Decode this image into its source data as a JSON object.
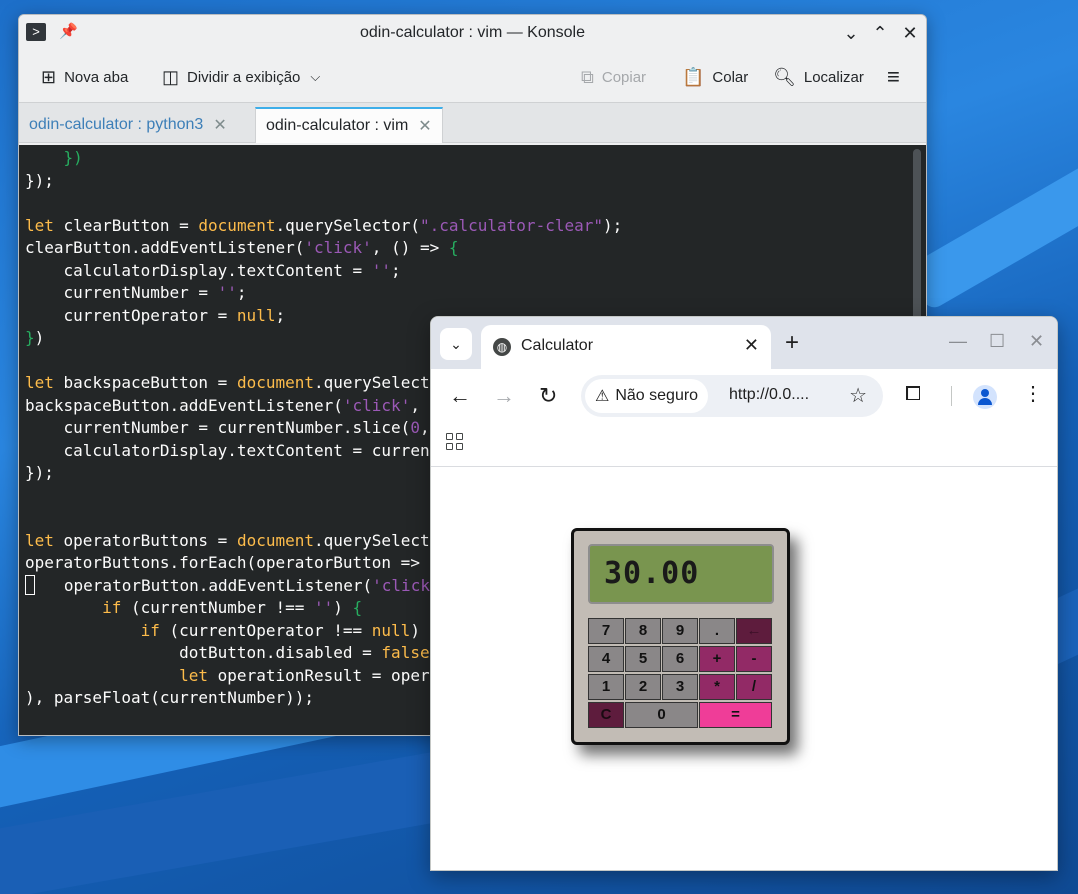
{
  "konsole": {
    "title": "odin-calculator : vim — Konsole",
    "toolbar": {
      "new_tab": "Nova aba",
      "split_view": "Dividir a exibição",
      "copy": "Copiar",
      "paste": "Colar",
      "find": "Localizar"
    },
    "tabs": [
      {
        "label": "odin-calculator : python3",
        "active": false
      },
      {
        "label": "odin-calculator : vim",
        "active": true
      }
    ]
  },
  "chrome": {
    "tab_title": "Calculator",
    "security_label": "Não seguro",
    "url": "http://0.0...."
  },
  "calculator": {
    "display": "30.00",
    "buttons": [
      "7",
      "8",
      "9",
      ".",
      "←",
      "4",
      "5",
      "6",
      "+",
      "-",
      "1",
      "2",
      "3",
      "*",
      "/",
      "C",
      "0",
      "="
    ],
    "colors": {
      "body": "#c2bcb5",
      "display": "#79954f",
      "operator": "#922a66",
      "equals": "#ef3d98",
      "number": "#8a8788"
    }
  },
  "icons": [
    "terminal-icon",
    "pin-icon",
    "new-tab-icon",
    "split-view-icon",
    "copy-icon",
    "paste-icon",
    "search-icon",
    "hamburger-menu-icon",
    "globe-icon",
    "back-arrow-icon",
    "forward-arrow-icon",
    "reload-icon",
    "warning-icon",
    "star-icon",
    "extensions-icon",
    "profile-icon",
    "kebab-menu-icon",
    "apps-grid-icon"
  ]
}
